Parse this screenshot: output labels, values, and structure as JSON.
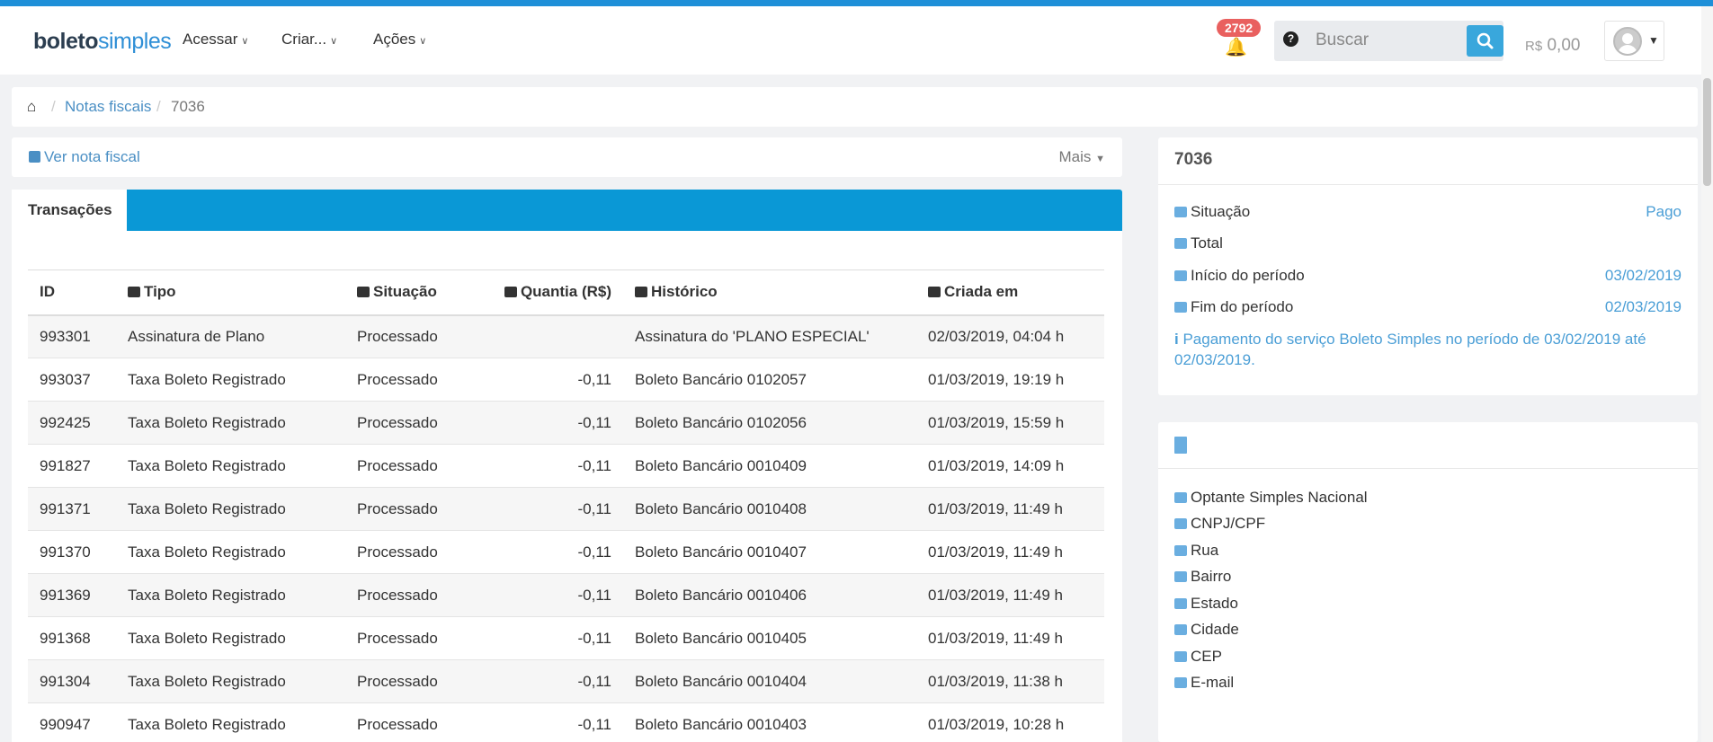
{
  "brand": {
    "part1": "boleto",
    "part2": "simples"
  },
  "nav": {
    "menus": [
      {
        "label": "Acessar"
      },
      {
        "label": "Criar..."
      },
      {
        "label": "Ações"
      }
    ],
    "notifications": "2792",
    "search_placeholder": "Buscar",
    "balance_currency": "R$",
    "balance_value": "0,00"
  },
  "breadcrumb": {
    "link": "Notas fiscais",
    "current": "7036"
  },
  "actions": {
    "view_invoice": "Ver nota fiscal",
    "more": "Mais"
  },
  "tabs": {
    "active": "Transações"
  },
  "table": {
    "headers": {
      "id": "ID",
      "tipo": "Tipo",
      "situacao": "Situação",
      "quantia": "Quantia (R$)",
      "historico": "Histórico",
      "criada": "Criada em"
    },
    "rows": [
      {
        "id": "993301",
        "tipo": "Assinatura de Plano",
        "situacao": "Processado",
        "quantia": "",
        "historico": "Assinatura do 'PLANO ESPECIAL'",
        "criada": "02/03/2019, 04:04 h"
      },
      {
        "id": "993037",
        "tipo": "Taxa Boleto Registrado",
        "situacao": "Processado",
        "quantia": "-0,11",
        "historico": "Boleto Bancário 0102057",
        "criada": "01/03/2019, 19:19 h"
      },
      {
        "id": "992425",
        "tipo": "Taxa Boleto Registrado",
        "situacao": "Processado",
        "quantia": "-0,11",
        "historico": "Boleto Bancário 0102056",
        "criada": "01/03/2019, 15:59 h"
      },
      {
        "id": "991827",
        "tipo": "Taxa Boleto Registrado",
        "situacao": "Processado",
        "quantia": "-0,11",
        "historico": "Boleto Bancário 0010409",
        "criada": "01/03/2019, 14:09 h"
      },
      {
        "id": "991371",
        "tipo": "Taxa Boleto Registrado",
        "situacao": "Processado",
        "quantia": "-0,11",
        "historico": "Boleto Bancário 0010408",
        "criada": "01/03/2019, 11:49 h"
      },
      {
        "id": "991370",
        "tipo": "Taxa Boleto Registrado",
        "situacao": "Processado",
        "quantia": "-0,11",
        "historico": "Boleto Bancário 0010407",
        "criada": "01/03/2019, 11:49 h"
      },
      {
        "id": "991369",
        "tipo": "Taxa Boleto Registrado",
        "situacao": "Processado",
        "quantia": "-0,11",
        "historico": "Boleto Bancário 0010406",
        "criada": "01/03/2019, 11:49 h"
      },
      {
        "id": "991368",
        "tipo": "Taxa Boleto Registrado",
        "situacao": "Processado",
        "quantia": "-0,11",
        "historico": "Boleto Bancário 0010405",
        "criada": "01/03/2019, 11:49 h"
      },
      {
        "id": "991304",
        "tipo": "Taxa Boleto Registrado",
        "situacao": "Processado",
        "quantia": "-0,11",
        "historico": "Boleto Bancário 0010404",
        "criada": "01/03/2019, 11:38 h"
      },
      {
        "id": "990947",
        "tipo": "Taxa Boleto Registrado",
        "situacao": "Processado",
        "quantia": "-0,11",
        "historico": "Boleto Bancário 0010403",
        "criada": "01/03/2019, 10:28 h"
      }
    ]
  },
  "invoice": {
    "title": "7036",
    "situacao_label": "Situação",
    "situacao_value": "Pago",
    "total_label": "Total",
    "inicio_label": "Início do período",
    "inicio_value": "03/02/2019",
    "fim_label": "Fim do período",
    "fim_value": "02/03/2019",
    "info": "Pagamento do serviço Boleto Simples no período de 03/02/2019 até 02/03/2019."
  },
  "company": {
    "fields": [
      "Optante Simples Nacional",
      "CNPJ/CPF",
      "Rua",
      "Bairro",
      "Estado",
      "Cidade",
      "CEP",
      "E-mail"
    ]
  },
  "colors": {
    "accent": "#0a98d6",
    "link": "#4a8fc4",
    "badge": "#e9605f"
  }
}
